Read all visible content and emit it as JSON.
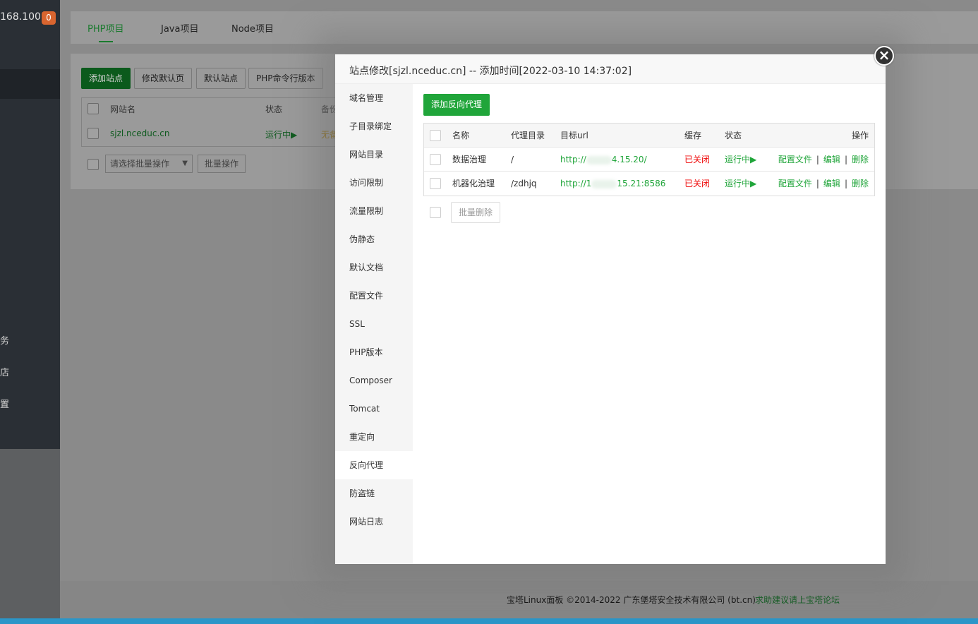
{
  "sidebar": {
    "ip": "168.100",
    "badge": "0",
    "fragments": [
      "",
      "务",
      "店",
      "置"
    ]
  },
  "tabs": [
    {
      "label": "PHP项目"
    },
    {
      "label": "Java项目"
    },
    {
      "label": "Node项目"
    }
  ],
  "toolbar": {
    "add_site": "添加站点",
    "edit_default": "修改默认页",
    "default_site": "默认站点",
    "php_cli": "PHP命令行版本"
  },
  "site_table": {
    "headers": [
      "网站名",
      "状态",
      "备份"
    ],
    "row": {
      "name": "sjzl.nceduc.cn",
      "status": "运行中▶",
      "backup": "无备"
    }
  },
  "batch": {
    "select_placeholder": "请选择批量操作",
    "button": "批量操作"
  },
  "footer": {
    "copyright": "宝塔Linux面板 ©2014-2022 广东堡塔安全技术有限公司 (bt.cn)",
    "link": "求助建议请上宝塔论坛"
  },
  "modal": {
    "title": "站点修改[sjzl.nceduc.cn] -- 添加时间[2022-03-10 14:37:02]",
    "close": "×",
    "menu": [
      "域名管理",
      "子目录绑定",
      "网站目录",
      "访问限制",
      "流量限制",
      "伪静态",
      "默认文档",
      "配置文件",
      "SSL",
      "PHP版本",
      "Composer",
      "Tomcat",
      "重定向",
      "反向代理",
      "防盗链",
      "网站日志"
    ],
    "active_menu": "反向代理",
    "add_proxy": "添加反向代理",
    "proxy_table": {
      "headers": {
        "name": "名称",
        "dir": "代理目录",
        "url": "目标url",
        "cache": "缓存",
        "status": "状态",
        "ops": "操作"
      },
      "rows": [
        {
          "name": "数据治理",
          "dir": "/",
          "url_prefix": "http://",
          "url_suffix": "4.15.20/",
          "cache": "已关闭",
          "status": "运行中▶",
          "op_config": "配置文件",
          "op_edit": "编辑",
          "op_delete": "删除"
        },
        {
          "name": "机器化治理",
          "dir": "/zdhjq",
          "url_prefix": "http://1",
          "url_suffix": "15.21:8586",
          "cache": "已关闭",
          "status": "运行中▶",
          "op_config": "配置文件",
          "op_edit": "编辑",
          "op_delete": "删除"
        }
      ]
    },
    "bulk_delete": "批量删除"
  }
}
